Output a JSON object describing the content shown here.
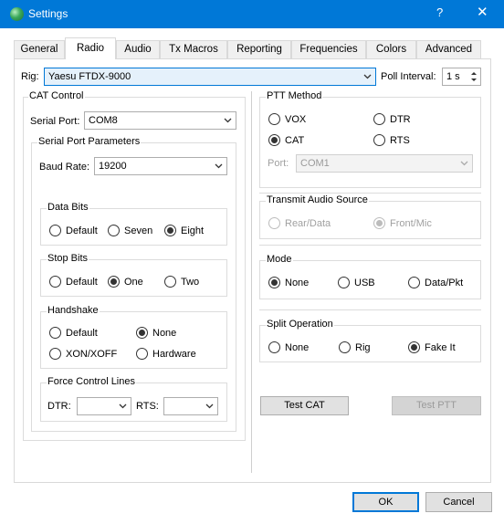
{
  "window": {
    "title": "Settings",
    "help": "?",
    "close": "✕"
  },
  "tabs": [
    {
      "label": "General"
    },
    {
      "label": "Radio"
    },
    {
      "label": "Audio"
    },
    {
      "label": "Tx Macros"
    },
    {
      "label": "Reporting"
    },
    {
      "label": "Frequencies"
    },
    {
      "label": "Colors"
    },
    {
      "label": "Advanced"
    }
  ],
  "active_tab": "Radio",
  "rig": {
    "label": "Rig:",
    "value": "Yaesu FTDX-9000"
  },
  "poll": {
    "label": "Poll Interval:",
    "value": "1 s"
  },
  "cat": {
    "title": "CAT Control",
    "serial_port_label": "Serial Port:",
    "serial_port_value": "COM8",
    "params_title": "Serial Port Parameters",
    "baud_label": "Baud Rate:",
    "baud_value": "19200",
    "data_bits": {
      "title": "Data Bits",
      "options": [
        "Default",
        "Seven",
        "Eight"
      ],
      "selected": "Eight"
    },
    "stop_bits": {
      "title": "Stop Bits",
      "options": [
        "Default",
        "One",
        "Two"
      ],
      "selected": "One"
    },
    "handshake": {
      "title": "Handshake",
      "options": [
        "Default",
        "None",
        "XON/XOFF",
        "Hardware"
      ],
      "selected": "None"
    },
    "force": {
      "title": "Force Control Lines",
      "dtr_label": "DTR:",
      "rts_label": "RTS:"
    }
  },
  "ptt": {
    "title": "PTT Method",
    "options": [
      "VOX",
      "DTR",
      "CAT",
      "RTS"
    ],
    "selected": "CAT",
    "port_label": "Port:",
    "port_value": "COM1"
  },
  "audio_source": {
    "title": "Transmit Audio Source",
    "options": [
      "Rear/Data",
      "Front/Mic"
    ],
    "selected": "Front/Mic"
  },
  "mode": {
    "title": "Mode",
    "options": [
      "None",
      "USB",
      "Data/Pkt"
    ],
    "selected": "None"
  },
  "split": {
    "title": "Split Operation",
    "options": [
      "None",
      "Rig",
      "Fake It"
    ],
    "selected": "Fake It"
  },
  "buttons": {
    "test_cat": "Test CAT",
    "test_ptt": "Test PTT",
    "ok": "OK",
    "cancel": "Cancel"
  },
  "colors": {
    "title_bar": "#0078d7",
    "focus": "#0078d7"
  }
}
